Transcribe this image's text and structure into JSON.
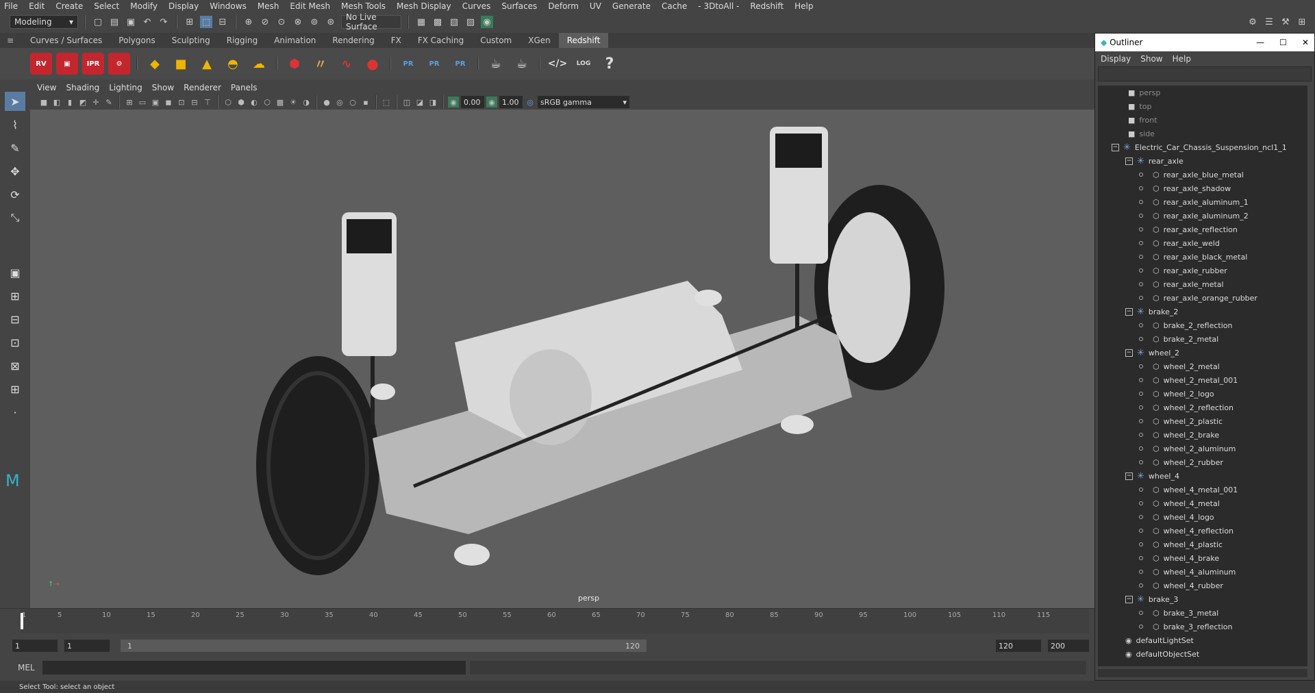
{
  "menubar": [
    "File",
    "Edit",
    "Create",
    "Select",
    "Modify",
    "Display",
    "Windows",
    "Mesh",
    "Edit Mesh",
    "Mesh Tools",
    "Mesh Display",
    "Curves",
    "Surfaces",
    "Deform",
    "UV",
    "Generate",
    "Cache",
    "- 3DtoAll -",
    "Redshift",
    "Help"
  ],
  "status": {
    "mode": "Modeling",
    "live_surface": "No Live Surface"
  },
  "shelf_tabs": [
    "Curves / Surfaces",
    "Polygons",
    "Sculpting",
    "Rigging",
    "Animation",
    "Rendering",
    "FX",
    "FX Caching",
    "Custom",
    "XGen",
    "Redshift"
  ],
  "shelf_active": "Redshift",
  "shelf_icons": {
    "rv": "RV",
    "ipr": "IPR",
    "pr": "PR",
    "log": "LOG",
    "help": "?"
  },
  "panel_menu": [
    "View",
    "Shading",
    "Lighting",
    "Show",
    "Renderer",
    "Panels"
  ],
  "panel_tools": {
    "exposure": "0.00",
    "gamma": "1.00",
    "color_space": "sRGB gamma"
  },
  "viewport": {
    "camera": "persp"
  },
  "timeline": {
    "ticks": [
      "1",
      "5",
      "10",
      "15",
      "20",
      "25",
      "30",
      "35",
      "40",
      "45",
      "50",
      "55",
      "60",
      "65",
      "70",
      "75",
      "80",
      "85",
      "90",
      "95",
      "100",
      "105",
      "110",
      "115"
    ]
  },
  "range": {
    "start": "1",
    "current": "1",
    "range_start": "1",
    "range_end": "120",
    "end": "120",
    "max": "200"
  },
  "command": {
    "label": "MEL"
  },
  "help": "Select Tool: select an object",
  "outliner": {
    "title": "Outliner",
    "menu": [
      "Display",
      "Show",
      "Help"
    ],
    "cameras": [
      "persp",
      "top",
      "front",
      "side"
    ],
    "root": "Electric_Car_Chassis_Suspension_ncl1_1",
    "groups": [
      {
        "name": "rear_axle",
        "items": [
          "rear_axle_blue_metal",
          "rear_axle_shadow",
          "rear_axle_aluminum_1",
          "rear_axle_aluminum_2",
          "rear_axle_reflection",
          "rear_axle_weld",
          "rear_axle_black_metal",
          "rear_axle_rubber",
          "rear_axle_metal",
          "rear_axle_orange_rubber"
        ]
      },
      {
        "name": "brake_2",
        "items": [
          "brake_2_reflection",
          "brake_2_metal"
        ]
      },
      {
        "name": "wheel_2",
        "items": [
          "wheel_2_metal",
          "wheel_2_metal_001",
          "wheel_2_logo",
          "wheel_2_reflection",
          "wheel_2_plastic",
          "wheel_2_brake",
          "wheel_2_aluminum",
          "wheel_2_rubber"
        ]
      },
      {
        "name": "wheel_4",
        "items": [
          "wheel_4_metal_001",
          "wheel_4_metal",
          "wheel_4_logo",
          "wheel_4_reflection",
          "wheel_4_plastic",
          "wheel_4_brake",
          "wheel_4_aluminum",
          "wheel_4_rubber"
        ]
      },
      {
        "name": "brake_3",
        "items": [
          "brake_3_metal",
          "brake_3_reflection"
        ]
      }
    ],
    "sets": [
      "defaultLightSet",
      "defaultObjectSet"
    ]
  }
}
